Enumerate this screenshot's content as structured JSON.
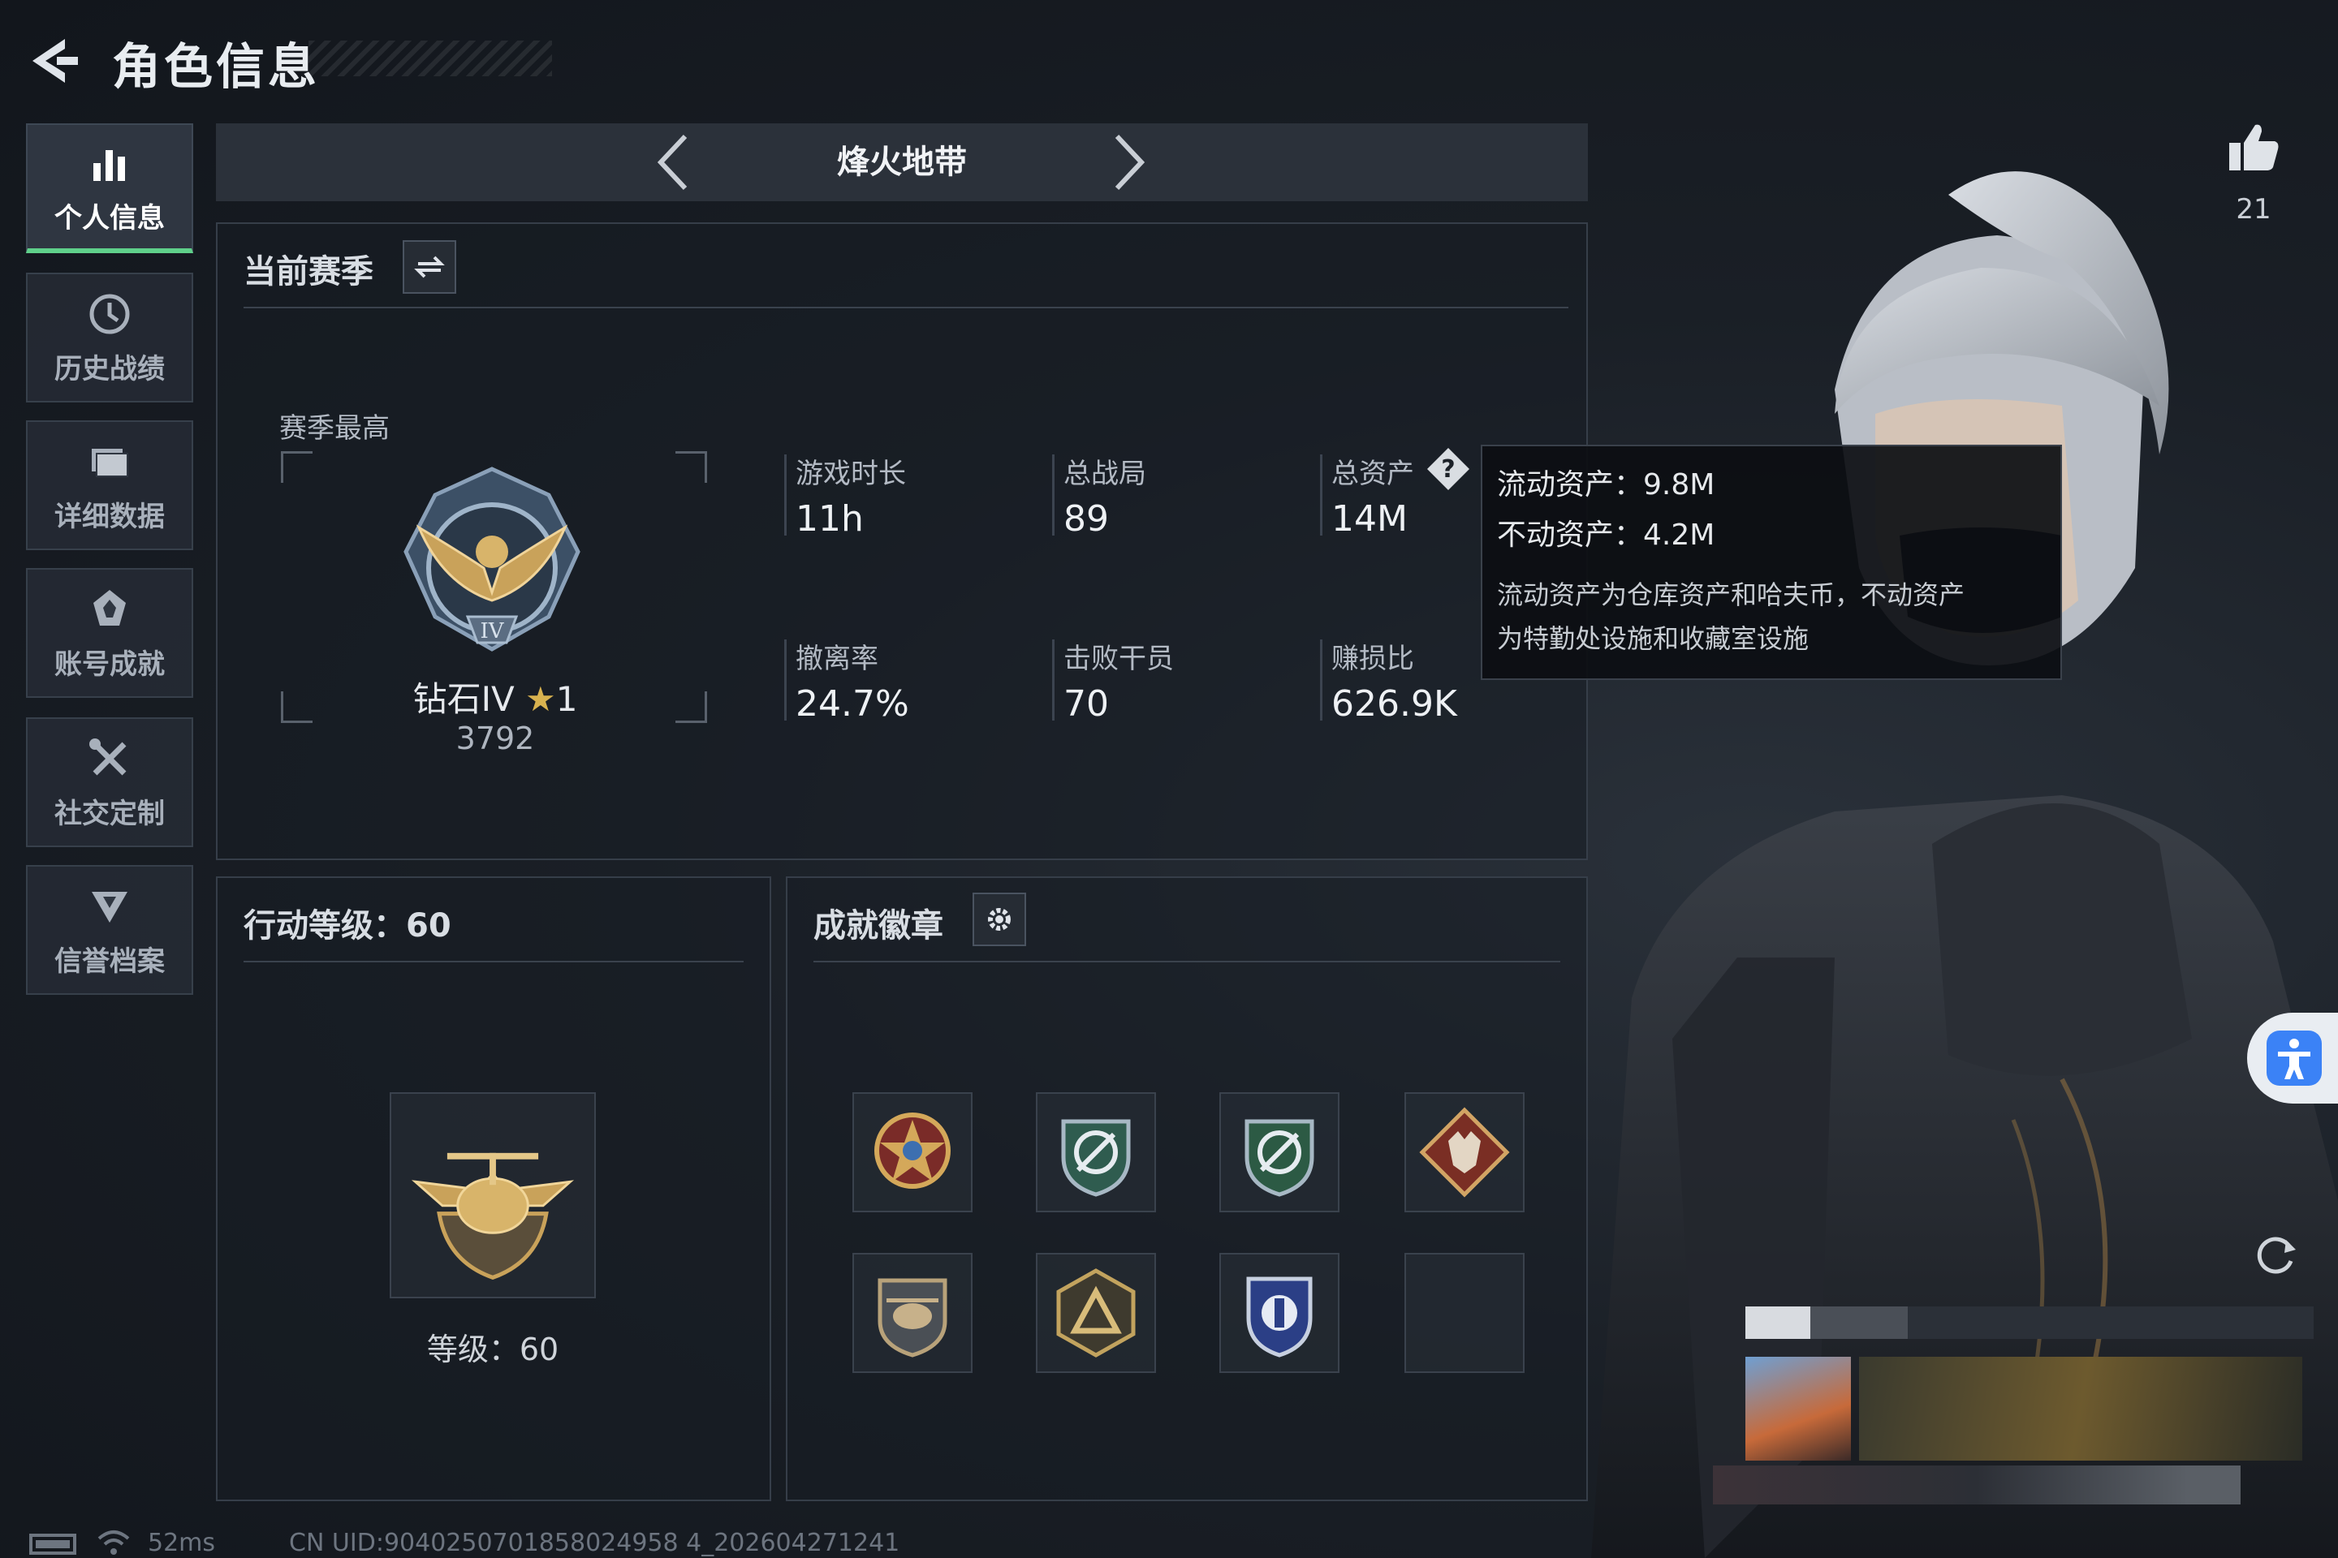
{
  "header": {
    "title": "角色信息"
  },
  "sidebar": {
    "items": [
      {
        "label": "个人信息",
        "icon": "bar-chart-icon",
        "active": true
      },
      {
        "label": "历史战绩",
        "icon": "clock-icon",
        "active": false
      },
      {
        "label": "详细数据",
        "icon": "folder-icon",
        "active": false
      },
      {
        "label": "账号成就",
        "icon": "achievement-icon",
        "active": false
      },
      {
        "label": "社交定制",
        "icon": "tools-icon",
        "active": false
      },
      {
        "label": "信誉档案",
        "icon": "shield-emblem-icon",
        "active": false
      }
    ]
  },
  "mode": {
    "name": "烽火地带"
  },
  "season": {
    "title": "当前赛季",
    "best_label": "赛季最高",
    "rank_name": "钻石IV",
    "rank_stars": "1",
    "rank_points": "3792",
    "stats": [
      {
        "label": "游戏时长",
        "value": "11h"
      },
      {
        "label": "总战局",
        "value": "89"
      },
      {
        "label": "总资产",
        "value": "14M"
      },
      {
        "label": "撤离率",
        "value": "24.7%"
      },
      {
        "label": "击败干员",
        "value": "70"
      },
      {
        "label": "赚损比",
        "value": "626.9K"
      }
    ]
  },
  "tooltip": {
    "liquid": "流动资产：9.8M",
    "fixed": "不动资产：4.2M",
    "desc_line1": "流动资产为仓库资产和哈夫币，不动资产",
    "desc_line2": "为特勤处设施和收藏室设施"
  },
  "action_level": {
    "title": "行动等级：60",
    "level_label": "等级：60"
  },
  "achievements": {
    "title": "成就徽章",
    "badges": [
      "star-medal-icon",
      "green-shield-icon",
      "green-shield-icon",
      "wolf-diamond-icon",
      "helicopter-badge-icon",
      "triangle-badge-icon",
      "blue-shield-icon",
      "empty"
    ]
  },
  "likes": {
    "count": "21"
  },
  "footer": {
    "ping": "52ms",
    "uid": "CN UID:9040250701858024958 4_202604271241"
  },
  "colors": {
    "accent_green": "#5fd08a",
    "accessibility_blue": "#3b82f6"
  }
}
